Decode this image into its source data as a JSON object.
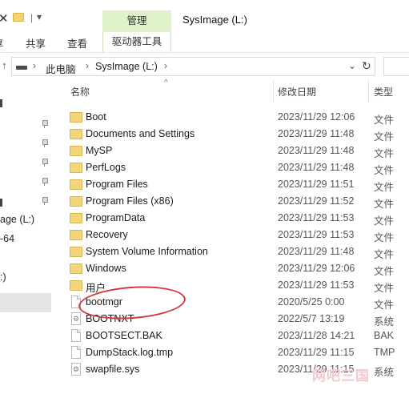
{
  "window": {
    "title": "SysImage (L:)",
    "context_tab": "管理"
  },
  "ribbon": {
    "tabs": [
      "享",
      "共享",
      "查看"
    ],
    "context_tab_lower": "驱动器工具"
  },
  "address": {
    "crumbs": [
      "此电脑",
      "SysImage (L:)"
    ]
  },
  "nav": {
    "labels": [
      "age (L:)",
      "-64",
      ":)"
    ]
  },
  "columns": {
    "name": "名称",
    "date": "修改日期",
    "type": "类型"
  },
  "files": [
    {
      "name": "Boot",
      "date": "2023/11/29 12:06",
      "type": "文件",
      "icon": "folder-icon"
    },
    {
      "name": "Documents and Settings",
      "date": "2023/11/29 11:48",
      "type": "文件",
      "icon": "folder-icon"
    },
    {
      "name": "MySP",
      "date": "2023/11/29 11:48",
      "type": "文件",
      "icon": "folder-icon"
    },
    {
      "name": "PerfLogs",
      "date": "2023/11/29 11:48",
      "type": "文件",
      "icon": "folder-icon"
    },
    {
      "name": "Program Files",
      "date": "2023/11/29 11:51",
      "type": "文件",
      "icon": "folder-icon"
    },
    {
      "name": "Program Files (x86)",
      "date": "2023/11/29 11:52",
      "type": "文件",
      "icon": "folder-icon"
    },
    {
      "name": "ProgramData",
      "date": "2023/11/29 11:53",
      "type": "文件",
      "icon": "folder-icon"
    },
    {
      "name": "Recovery",
      "date": "2023/11/29 11:53",
      "type": "文件",
      "icon": "folder-icon"
    },
    {
      "name": "System Volume Information",
      "date": "2023/11/29 11:48",
      "type": "文件",
      "icon": "folder-icon"
    },
    {
      "name": "Windows",
      "date": "2023/11/29 12:06",
      "type": "文件",
      "icon": "folder-icon"
    },
    {
      "name": "用户",
      "date": "2023/11/29 11:53",
      "type": "文件",
      "icon": "folder-icon"
    },
    {
      "name": "bootmgr",
      "date": "2020/5/25 0:00",
      "type": "文件",
      "icon": "file-icon"
    },
    {
      "name": "BOOTNXT",
      "date": "2022/5/7 13:19",
      "type": "系统",
      "icon": "system-file-icon"
    },
    {
      "name": "BOOTSECT.BAK",
      "date": "2023/11/28 14:21",
      "type": "BAK",
      "icon": "file-icon"
    },
    {
      "name": "DumpStack.log.tmp",
      "date": "2023/11/29 11:15",
      "type": "TMP",
      "icon": "file-icon"
    },
    {
      "name": "swapfile.sys",
      "date": "2023/11/29 11:15",
      "type": "系统",
      "icon": "system-file-icon"
    }
  ],
  "watermark": "网吧三国",
  "colors": {
    "context_tab": "#dff1c8",
    "annotation": "#d23b3b",
    "folder": "#f4d67a",
    "selection": "#e5e5e5"
  }
}
